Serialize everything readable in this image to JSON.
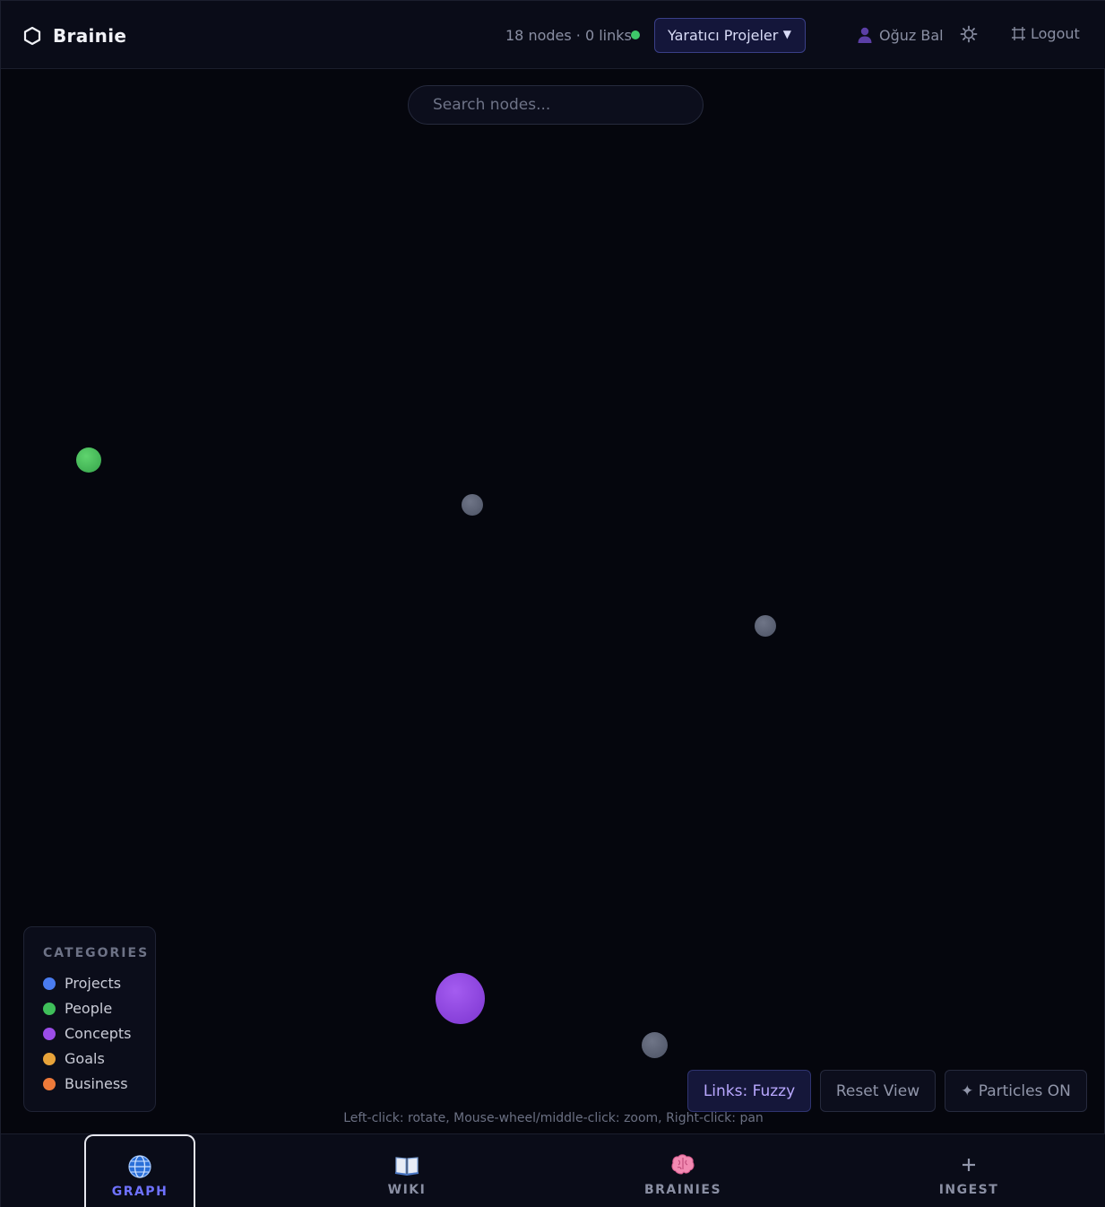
{
  "header": {
    "brand": "Brainie",
    "stats": "18 nodes · 0 links",
    "workspace": "Yaratıcı Projeler",
    "user": "Oğuz Bal",
    "logout": "Logout"
  },
  "search": {
    "placeholder": "Search nodes..."
  },
  "legend": {
    "title": "CATEGORIES",
    "items": [
      {
        "label": "Projects",
        "color": "#4a7cf0"
      },
      {
        "label": "People",
        "color": "#3fbf5a"
      },
      {
        "label": "Concepts",
        "color": "#9b4de8"
      },
      {
        "label": "Goals",
        "color": "#e8a33a"
      },
      {
        "label": "Business",
        "color": "#ee7a3a"
      }
    ]
  },
  "colors": {
    "accent": "#6f72ff",
    "status": "#3ec76a",
    "uncategorized_node": "#5a6070"
  },
  "controls": {
    "links": "Links: Fuzzy",
    "reset": "Reset View",
    "particles": "✦ Particles ON"
  },
  "hint": "Left-click: rotate, Mouse-wheel/middle-click: zoom, Right-click: pan",
  "nav": {
    "items": [
      {
        "label": "GRAPH",
        "icon": "globe-icon"
      },
      {
        "label": "WIKI",
        "icon": "book-icon"
      },
      {
        "label": "BRAINIES",
        "icon": "brain-icon"
      },
      {
        "label": "INGEST",
        "icon": "plus-icon"
      }
    ]
  }
}
